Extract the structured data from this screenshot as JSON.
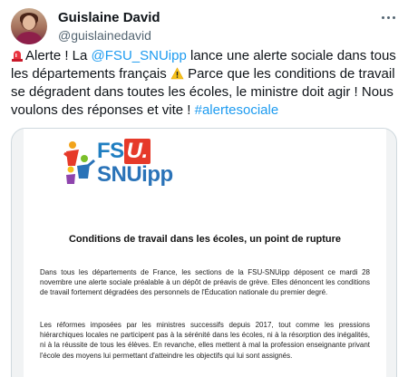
{
  "author": {
    "display_name": "Guislaine David",
    "handle": "@guislainedavid"
  },
  "tweet": {
    "seg1": "Alerte ! La ",
    "mention": "@FSU_SNUipp",
    "seg2": " lance une alerte sociale dans tous les départements français ",
    "seg3": " Parce que les conditions de travail se dégradent dans toutes les écoles, le ministre doit agir ! Nous voulons des réponses et vite ! ",
    "hashtag": "#alertesociale"
  },
  "document": {
    "logo_line1": "FS",
    "logo_u": "U.",
    "logo_line2": "SNUipp",
    "title": "Conditions de travail dans les écoles, un point de rupture",
    "paragraph1": "Dans tous les départements de France, les sections de la FSU-SNUipp déposent ce mardi 28 novembre une alerte sociale préalable à un dépôt de préavis de grève. Elles dénoncent les conditions de travail fortement dégradées des personnels de l'Éducation nationale du premier degré.",
    "paragraph2": "Les réformes imposées par les ministres successifs depuis 2017, tout comme les pressions hiérarchiques locales ne participent pas à la sérénité dans les écoles, ni à la résorption des inégalités, ni à la réussite de tous les élèves. En revanche, elles mettent à mal la profession enseignante privant l'école des moyens lui permettant d'atteindre les objectifs qui lui sont assignés."
  },
  "colors": {
    "link": "#1d9bf0",
    "text": "#0f1419",
    "secondary": "#536471",
    "logo_blue": "#1f7ec1",
    "logo_red": "#e63a2a"
  },
  "icons": {
    "more": "more-horizontal-icon",
    "alarm": "rotating-light-emoji",
    "warning": "warning-emoji"
  }
}
